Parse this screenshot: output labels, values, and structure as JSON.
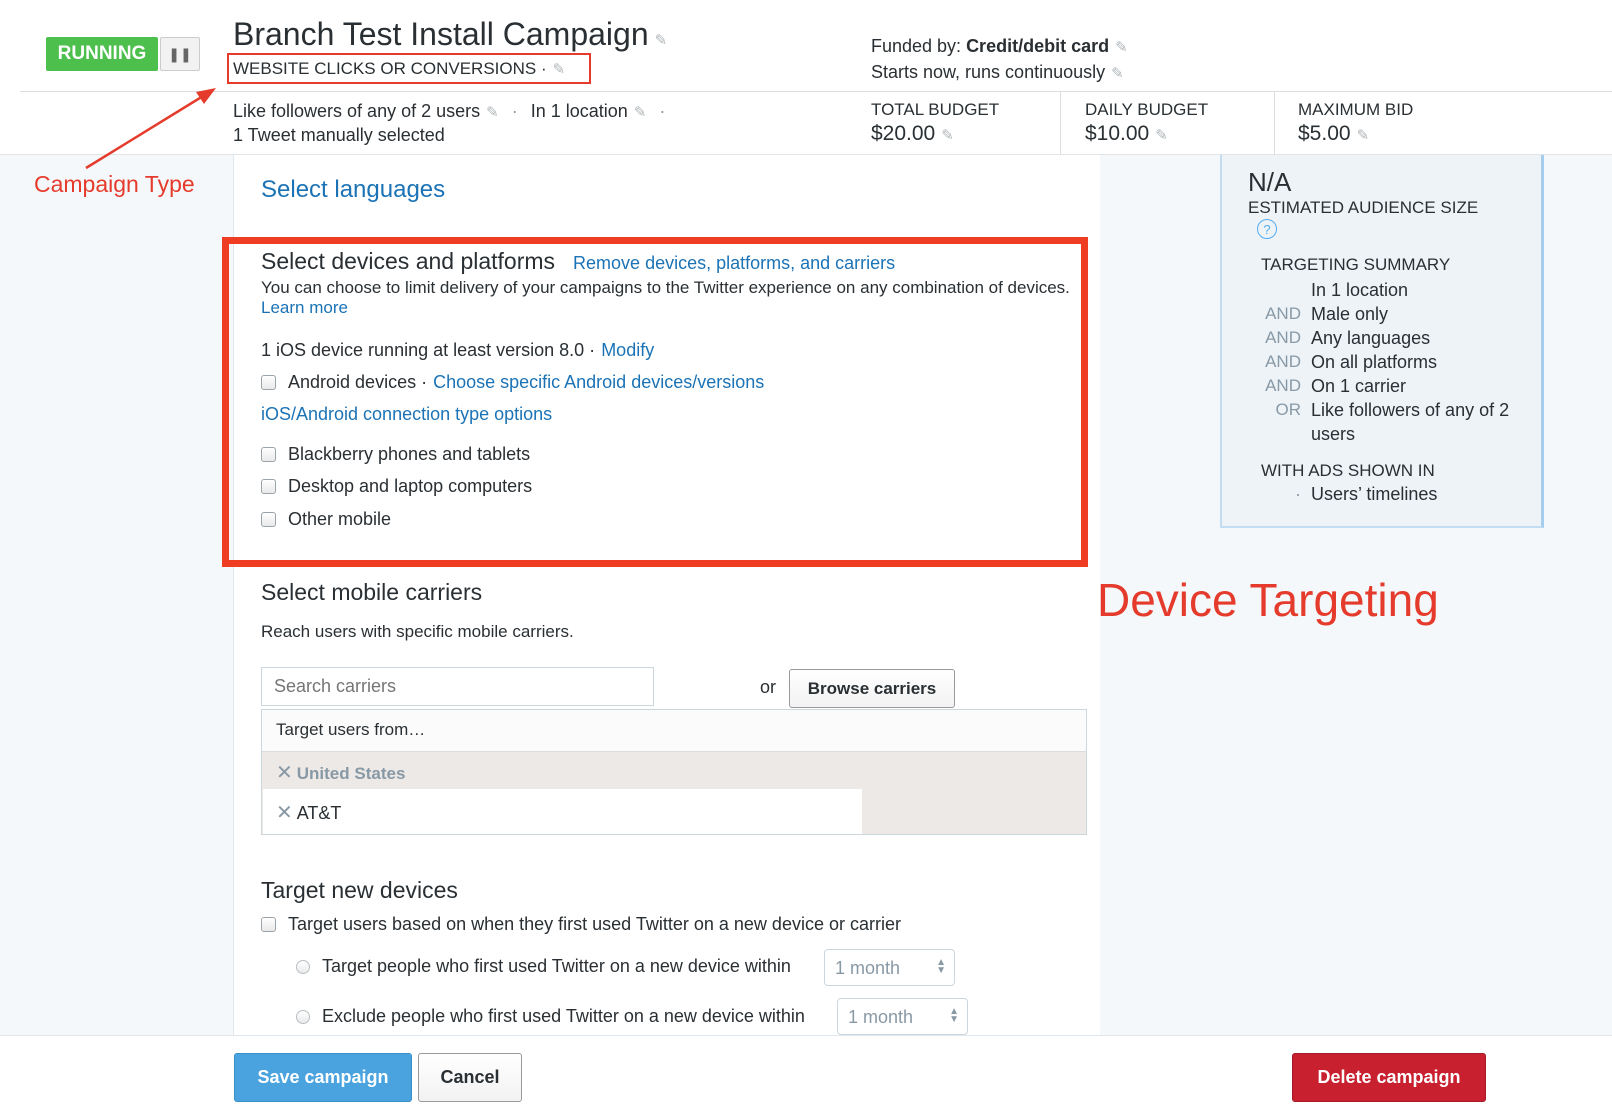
{
  "header": {
    "status_label": "RUNNING",
    "pause_icon": "pause-icon",
    "title": "Branch Test Install Campaign",
    "campaign_type": "WEBSITE CLICKS OR CONVERSIONS ·",
    "funded_label": "Funded by: ",
    "funded_value": "Credit/debit card",
    "schedule": "Starts now, runs continuously",
    "targeting_followers": "Like followers of any of 2 users",
    "targeting_location": "In 1 location",
    "tweets": "1 Tweet manually selected",
    "total_budget_label": "TOTAL BUDGET",
    "total_budget_value": "$20.00",
    "daily_budget_label": "DAILY BUDGET",
    "daily_budget_value": "$10.00",
    "max_bid_label": "MAXIMUM BID",
    "max_bid_value": "$5.00"
  },
  "annotations": {
    "campaign_type": "Campaign Type",
    "device_targeting": "Device Targeting"
  },
  "languages": {
    "link": "Select languages"
  },
  "devices": {
    "title": "Select devices and platforms",
    "remove_link": "Remove devices, platforms, and carriers",
    "description": "You can choose to limit delivery of your campaigns to the Twitter experience on any combination of devices.",
    "learn_more": "Learn more",
    "ios_text": "1 iOS device running at least version 8.0 ·",
    "modify_link": "Modify",
    "android_label": "Android devices ·",
    "android_link": "Choose specific Android devices/versions",
    "connection_link": "iOS/Android connection type options",
    "blackberry_label": "Blackberry phones and tablets",
    "desktop_label": "Desktop and laptop computers",
    "other_label": "Other mobile"
  },
  "carriers": {
    "title": "Select mobile carriers",
    "description": "Reach users with specific mobile carriers.",
    "search_placeholder": "Search carriers",
    "or": "or",
    "browse_button": "Browse carriers",
    "target_header": "Target users from…",
    "country": "United States",
    "carrier": "AT&T"
  },
  "new_devices": {
    "title": "Target new devices",
    "checkbox_label": "Target users based on when they first used Twitter on a new device or carrier",
    "target_label": "Target people who first used Twitter on a new device within",
    "target_value": "1 month",
    "exclude_label": "Exclude people who first used Twitter on a new device within",
    "exclude_value": "1 month"
  },
  "audience": {
    "size": "N/A",
    "size_label": "ESTIMATED AUDIENCE SIZE",
    "help": "?",
    "summary_title": "TARGETING SUMMARY",
    "summary": [
      {
        "op": "",
        "value": "In 1 location"
      },
      {
        "op": "AND",
        "value": "Male only"
      },
      {
        "op": "AND",
        "value": "Any languages"
      },
      {
        "op": "AND",
        "value": "On all platforms"
      },
      {
        "op": "AND",
        "value": "On 1 carrier"
      },
      {
        "op": "OR",
        "value": "Like followers of any of 2 users"
      }
    ],
    "with_ads_title": "WITH ADS SHOWN IN",
    "with_ads_bullet": "·",
    "with_ads_value": "Users’ timelines"
  },
  "footer": {
    "save": "Save campaign",
    "cancel": "Cancel",
    "delete": "Delete campaign"
  },
  "colors": {
    "running": "#4cbf4c",
    "link": "#1b73b6",
    "annotation": "#e53b2c",
    "save": "#4aa3df",
    "delete": "#c8202f"
  }
}
